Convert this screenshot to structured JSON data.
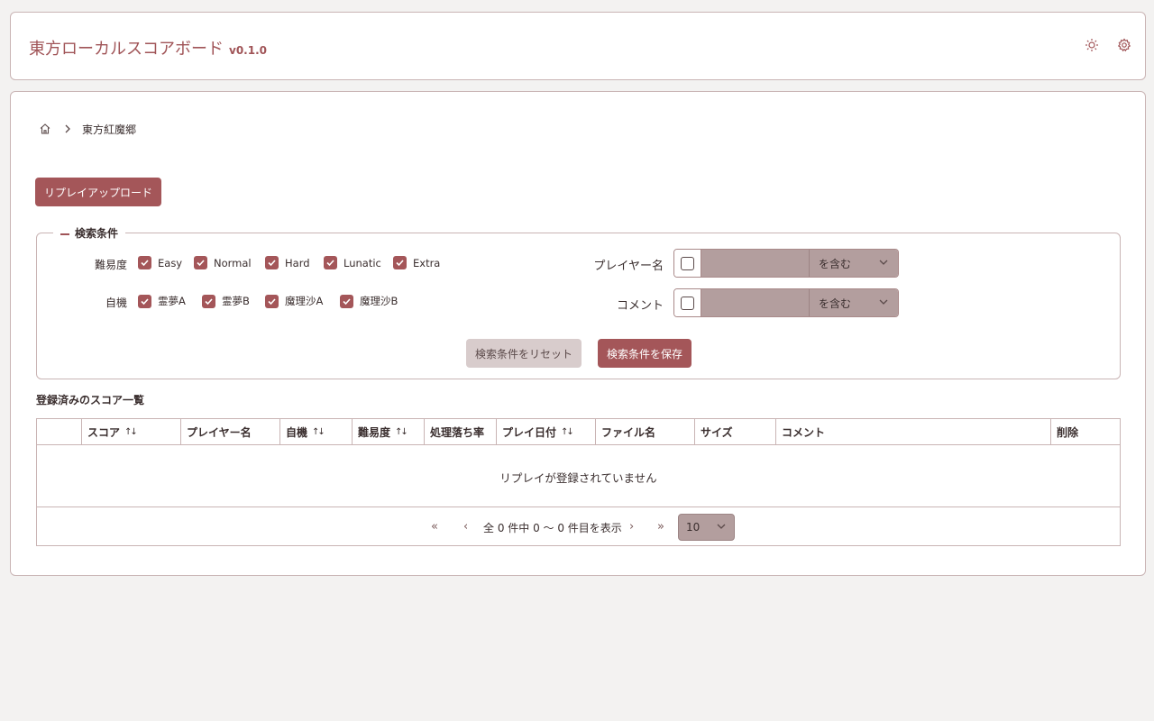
{
  "header": {
    "title": "東方ローカルスコアボード",
    "version": "v0.1.0",
    "icons": [
      "sun-icon",
      "gear-icon"
    ]
  },
  "breadcrumb": {
    "home_icon": "home-icon",
    "separator_icon": "chevron-right-icon",
    "current": "東方紅魔郷"
  },
  "upload_button": "リプレイアップロード",
  "search": {
    "legend": "検索条件",
    "difficulty": {
      "label": "難易度",
      "options": [
        {
          "label": "Easy",
          "checked": true
        },
        {
          "label": "Normal",
          "checked": true
        },
        {
          "label": "Hard",
          "checked": true
        },
        {
          "label": "Lunatic",
          "checked": true
        },
        {
          "label": "Extra",
          "checked": true
        }
      ]
    },
    "character": {
      "label": "自機",
      "options": [
        {
          "label": "霊夢A",
          "checked": true
        },
        {
          "label": "霊夢B",
          "checked": true
        },
        {
          "label": "魔理沙A",
          "checked": true
        },
        {
          "label": "魔理沙B",
          "checked": true
        }
      ]
    },
    "player_name": {
      "label": "プレイヤー名",
      "enabled": false,
      "value": "",
      "match_mode": "を含む"
    },
    "comment": {
      "label": "コメント",
      "enabled": false,
      "value": "",
      "match_mode": "を含む"
    },
    "reset_button": "検索条件をリセット",
    "save_button": "検索条件を保存"
  },
  "scores": {
    "section_title": "登録済みのスコア一覧",
    "columns": [
      {
        "label": "",
        "sortable": false
      },
      {
        "label": "スコア",
        "sortable": true
      },
      {
        "label": "プレイヤー名",
        "sortable": false
      },
      {
        "label": "自機",
        "sortable": true
      },
      {
        "label": "難易度",
        "sortable": true
      },
      {
        "label": "処理落ち率",
        "sortable": false
      },
      {
        "label": "プレイ日付",
        "sortable": true
      },
      {
        "label": "ファイル名",
        "sortable": false
      },
      {
        "label": "サイズ",
        "sortable": false
      },
      {
        "label": "コメント",
        "sortable": false
      },
      {
        "label": "削除",
        "sortable": false
      }
    ],
    "empty_message": "リプレイが登録されていません",
    "pagination": {
      "first": "«",
      "prev": "‹",
      "info": "全 0 件中 0 〜 0 件目を表示",
      "next": "›",
      "last": "»",
      "rows_per_page": "10"
    }
  },
  "colors": {
    "accent": "#a45659",
    "border": "#c9b4b4",
    "input_bg": "#b39e9e"
  }
}
